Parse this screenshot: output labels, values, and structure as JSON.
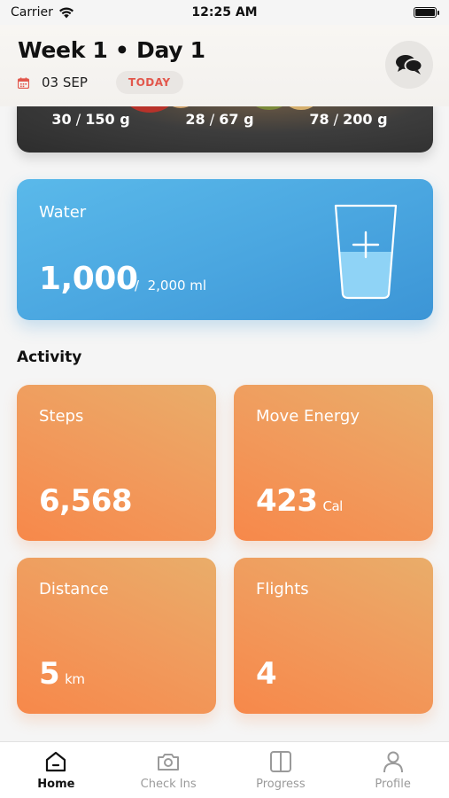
{
  "status_bar": {
    "carrier": "Carrier",
    "time": "12:25 AM"
  },
  "header": {
    "title": "Week 1 • Day 1",
    "date": "03 SEP",
    "today_badge": "TODAY"
  },
  "meal": {
    "macros": [
      {
        "value": "30",
        "goal": "150 g"
      },
      {
        "value": "28",
        "goal": "67 g"
      },
      {
        "value": "78",
        "goal": "200 g"
      }
    ]
  },
  "water": {
    "title": "Water",
    "amount": "1,000",
    "goal": "2,000 ml",
    "fill_fraction": 0.5
  },
  "activity": {
    "title": "Activity",
    "cards": [
      {
        "label": "Steps",
        "value": "6,568",
        "unit": ""
      },
      {
        "label": "Move Energy",
        "value": "423",
        "unit": "Cal"
      },
      {
        "label": "Distance",
        "value": "5",
        "unit": "km"
      },
      {
        "label": "Flights",
        "value": "4",
        "unit": ""
      }
    ]
  },
  "tabs": [
    {
      "label": "Home",
      "icon": "home-icon",
      "active": true
    },
    {
      "label": "Check Ins",
      "icon": "camera-icon",
      "active": false
    },
    {
      "label": "Progress",
      "icon": "progress-icon",
      "active": false
    },
    {
      "label": "Profile",
      "icon": "profile-icon",
      "active": false
    }
  ],
  "colors": {
    "water_card": "#4aa6e0",
    "activity_card": "#f19a5c",
    "today_badge_text": "#e2574c",
    "active_tab": "#111111",
    "inactive_tab": "#9a9a9a"
  }
}
